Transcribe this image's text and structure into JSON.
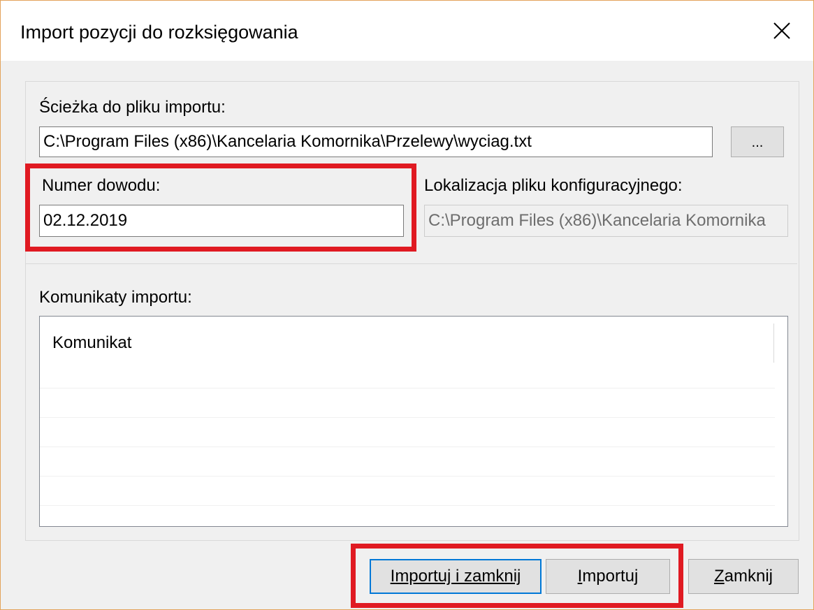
{
  "window": {
    "title": "Import pozycji do rozksięgowania",
    "close_icon": "close-icon",
    "border_color": "#e3a35b"
  },
  "file": {
    "label": "Ścieżka do pliku importu:",
    "value": "C:\\Program Files (x86)\\Kancelaria Komornika\\Przelewy\\wyciag.txt",
    "browse_label": "..."
  },
  "doc_number": {
    "label": "Numer dowodu:",
    "value": "02.12.2019"
  },
  "config": {
    "label": "Lokalizacja pliku konfiguracyjnego:",
    "value": "C:\\Program Files (x86)\\Kancelaria Komornika"
  },
  "messages": {
    "label": "Komunikaty importu:",
    "column_header": "Komunikat",
    "rows": [
      "",
      "",
      "",
      "",
      ""
    ]
  },
  "buttons": {
    "import_close": {
      "underline": "I",
      "rest": "mportuj i zamknij"
    },
    "import": {
      "underline": "I",
      "rest": "mportuj"
    },
    "close": {
      "underline": "Z",
      "rest": "amknij"
    }
  },
  "annotations": {
    "highlight_color": "#e01a22"
  }
}
